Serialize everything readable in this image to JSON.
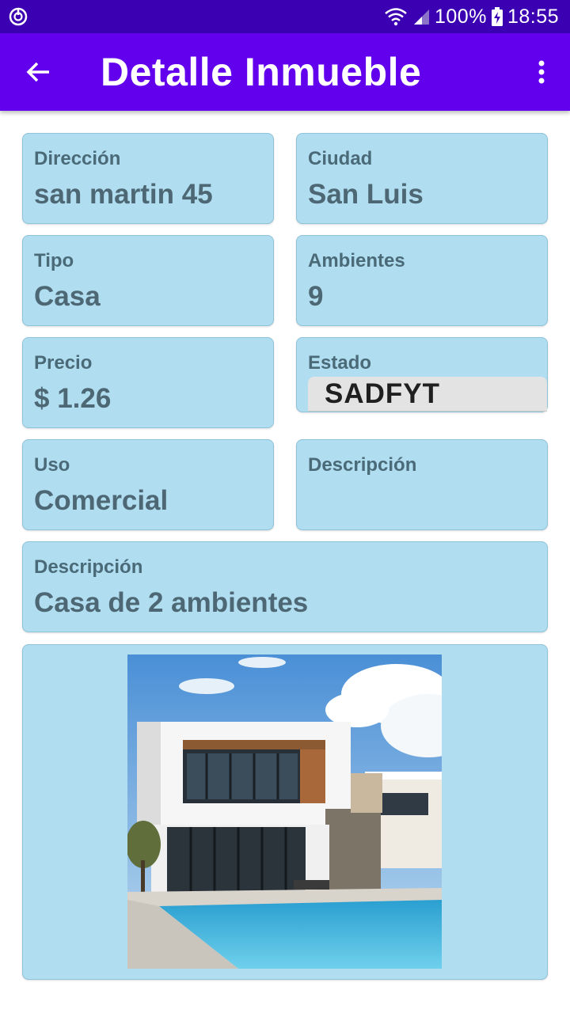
{
  "status_bar": {
    "battery": "100%",
    "time": "18:55",
    "icons": [
      "sync-icon",
      "wifi-icon",
      "cellular-icon",
      "battery-charging-icon"
    ]
  },
  "app_bar": {
    "title": "Detalle Inmueble",
    "back_icon": "arrow-back-icon",
    "menu_icon": "more-vert-icon"
  },
  "colors": {
    "status_bar": "#3b00b2",
    "app_bar": "#6200ee",
    "card_bg": "#b0ddf0",
    "label_text": "#4a6a78",
    "estado_bg": "#e3e3e3"
  },
  "fields": {
    "direccion": {
      "label": "Dirección",
      "value": "san martin 45"
    },
    "ciudad": {
      "label": "Ciudad",
      "value": "San Luis"
    },
    "tipo": {
      "label": "Tipo",
      "value": "Casa"
    },
    "ambientes": {
      "label": "Ambientes",
      "value": "9"
    },
    "precio": {
      "label": "Precio",
      "value": "$ 1.26"
    },
    "estado": {
      "label": "Estado",
      "value": "SADFYT"
    },
    "uso": {
      "label": "Uso",
      "value": "Comercial"
    },
    "descripcion_small": {
      "label": "Descripción",
      "value": ""
    },
    "descripcion": {
      "label": "Descripción",
      "value": "Casa  de 2 ambientes"
    }
  },
  "image": {
    "subject": "modern-house-with-pool-photo"
  }
}
